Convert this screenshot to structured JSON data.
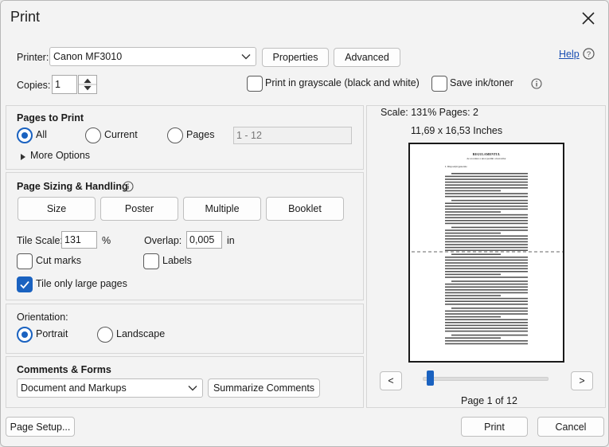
{
  "window": {
    "title": "Print"
  },
  "help": {
    "label": "Help"
  },
  "printer": {
    "label": "Printer:",
    "selected": "Canon MF3010",
    "properties_label": "Properties",
    "advanced_label": "Advanced"
  },
  "copies": {
    "label": "Copies:",
    "value": "1"
  },
  "grayscale": {
    "label": "Print in grayscale (black and white)",
    "checked": false
  },
  "save_ink": {
    "label": "Save ink/toner",
    "checked": false
  },
  "pages_to_print": {
    "title": "Pages to Print",
    "all_label": "All",
    "current_label": "Current",
    "pages_label": "Pages",
    "pages_range_value": "1 - 12",
    "more_options_label": "More Options",
    "selected": "All"
  },
  "page_sizing": {
    "title": "Page Sizing & Handling",
    "buttons": [
      "Size",
      "Poster",
      "Multiple",
      "Booklet"
    ],
    "tile_scale_label": "Tile Scale:",
    "tile_scale_value": "131",
    "tile_scale_unit": "%",
    "overlap_label": "Overlap:",
    "overlap_value": "0,005",
    "overlap_unit": "in",
    "cut_marks_label": "Cut marks",
    "cut_marks_checked": false,
    "labels_label": "Labels",
    "labels_checked": false,
    "tile_large_label": "Tile only large pages",
    "tile_large_checked": true
  },
  "orientation": {
    "title": "Orientation:",
    "portrait_label": "Portrait",
    "landscape_label": "Landscape",
    "selected": "Portrait"
  },
  "comments_forms": {
    "title": "Comments & Forms",
    "selected": "Document and Markups",
    "summarize_label": "Summarize Comments"
  },
  "preview": {
    "scale_text": "Scale: 131% Pages: 2",
    "size_text": "11,69 x 16,53 Inches",
    "doc_heading": "REGULAMENTUL",
    "doc_subheading": "de acordare a unor premii a lucrarilor",
    "doc_section": "I. Dispoziții generale",
    "prev_label": "<",
    "next_label": ">",
    "page_indicator": "Page 1 of 12",
    "slider_position": 0.02
  },
  "footer": {
    "page_setup_label": "Page Setup...",
    "print_label": "Print",
    "cancel_label": "Cancel"
  },
  "colors": {
    "accent": "#1a62c0",
    "link": "#1a4fb3"
  }
}
